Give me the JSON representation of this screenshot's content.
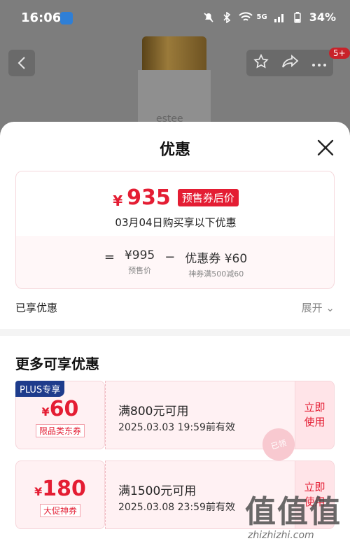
{
  "status_bar": {
    "time": "16:06",
    "network": "5G",
    "battery": "34%"
  },
  "nav": {
    "badge_count": "5+"
  },
  "product": {
    "bottle_text": "estee"
  },
  "sheet": {
    "title": "优惠",
    "price_card": {
      "yen": "¥",
      "price": "935",
      "tag": "预售券后价",
      "subtitle": "03月04日购买享以下优惠",
      "equals": "=",
      "presale_value": "¥995",
      "presale_caption": "预售价",
      "minus": "−",
      "coupon_value": "优惠券 ¥60",
      "coupon_caption": "神券满500减60"
    },
    "enjoyed_label": "已享优惠",
    "expand_label": "展开 ⌄",
    "more_title": "更多可享优惠",
    "coupons": [
      {
        "badge": "PLUS专享",
        "yen": "¥",
        "amount": "60",
        "type": "限品类东券",
        "condition": "满800元可用",
        "expire": "2025.03.03 19:59前有效",
        "action": "立即使用",
        "stamp": "已领"
      },
      {
        "yen": "¥",
        "amount": "180",
        "type": "大促神券",
        "condition": "满1500元可用",
        "expire": "2025.03.08 23:59前有效",
        "action": "立即使用"
      }
    ]
  },
  "watermark": {
    "logo": "值值值",
    "text": "zhizhizhi.com"
  }
}
